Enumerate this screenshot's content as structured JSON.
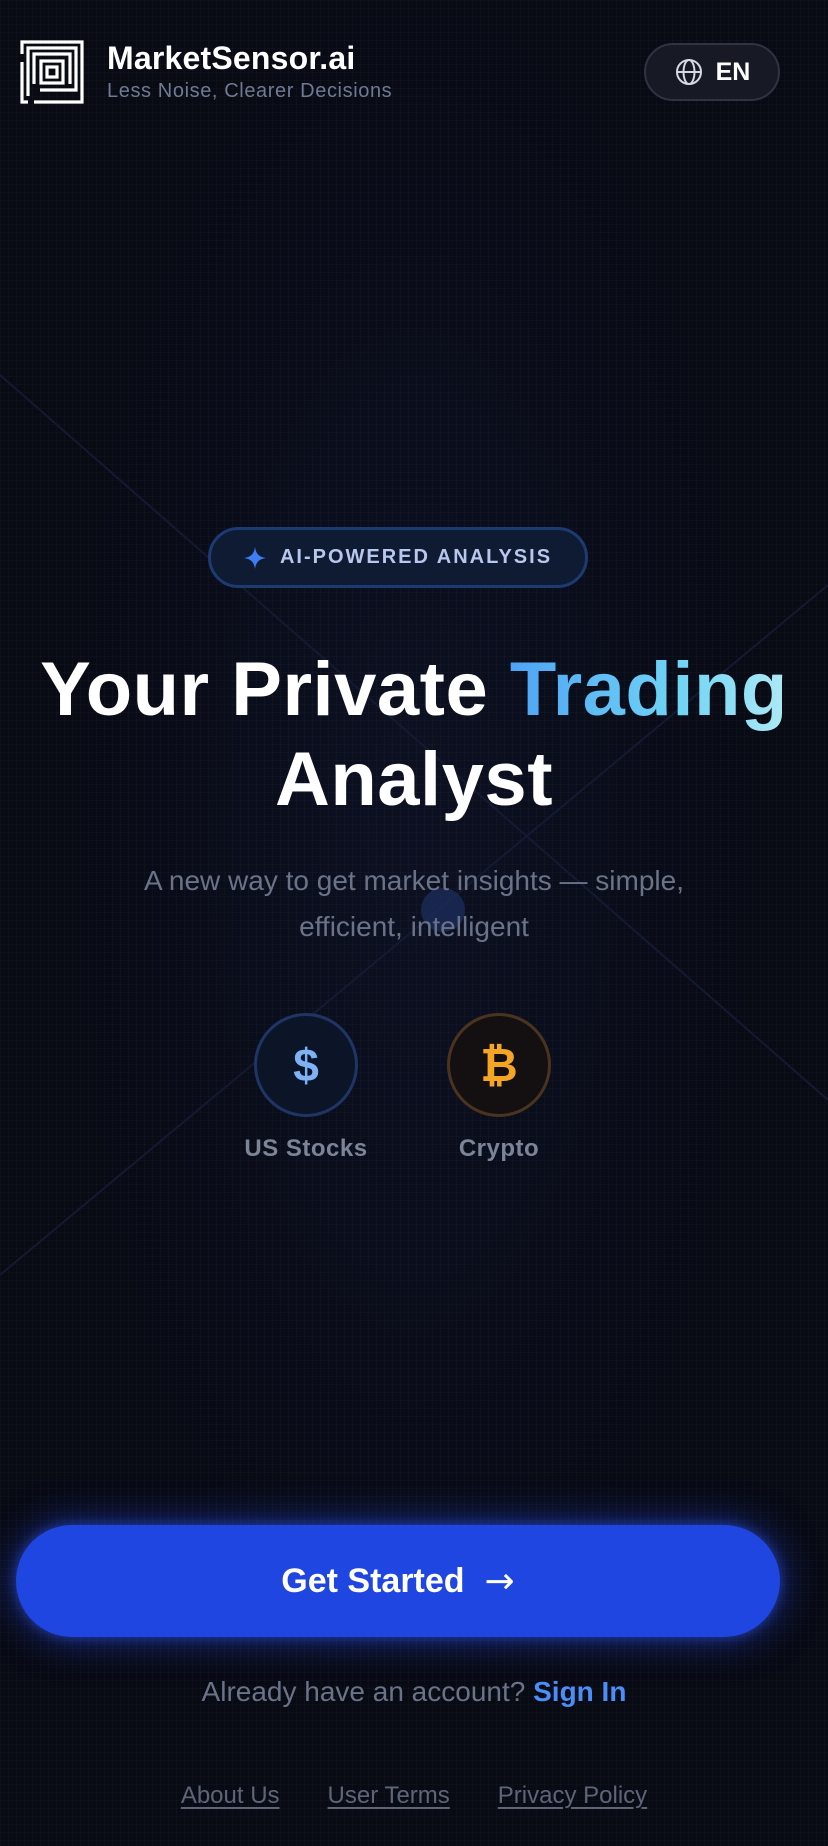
{
  "header": {
    "brand_name": "MarketSensor.ai",
    "tagline": "Less Noise, Clearer Decisions",
    "language": "EN",
    "logo_icon": "maze-logo-icon",
    "language_icon": "globe-icon"
  },
  "hero": {
    "badge_label": "AI-POWERED ANALYSIS",
    "badge_icon": "sparkle-icon",
    "title_part1": "Your Private ",
    "title_accent": "Trading",
    "title_part2": "Analyst",
    "subtitle": "A new way to get market insights — simple, efficient, intelligent"
  },
  "markets": [
    {
      "label": "US Stocks",
      "symbol": "$",
      "icon": "dollar-icon",
      "color": "#7fb2f4"
    },
    {
      "label": "Crypto",
      "symbol": "₿",
      "icon": "bitcoin-icon",
      "color": "#f5a524"
    }
  ],
  "cta": {
    "label": "Get Started",
    "arrow": "→"
  },
  "signin": {
    "prompt": "Already have an account?",
    "link": "Sign In"
  },
  "footer": {
    "links": [
      "About Us",
      "User Terms",
      "Privacy Policy"
    ]
  },
  "colors": {
    "background": "#080a14",
    "primary": "#1f46e0",
    "accent_text": "#4d8df7"
  }
}
